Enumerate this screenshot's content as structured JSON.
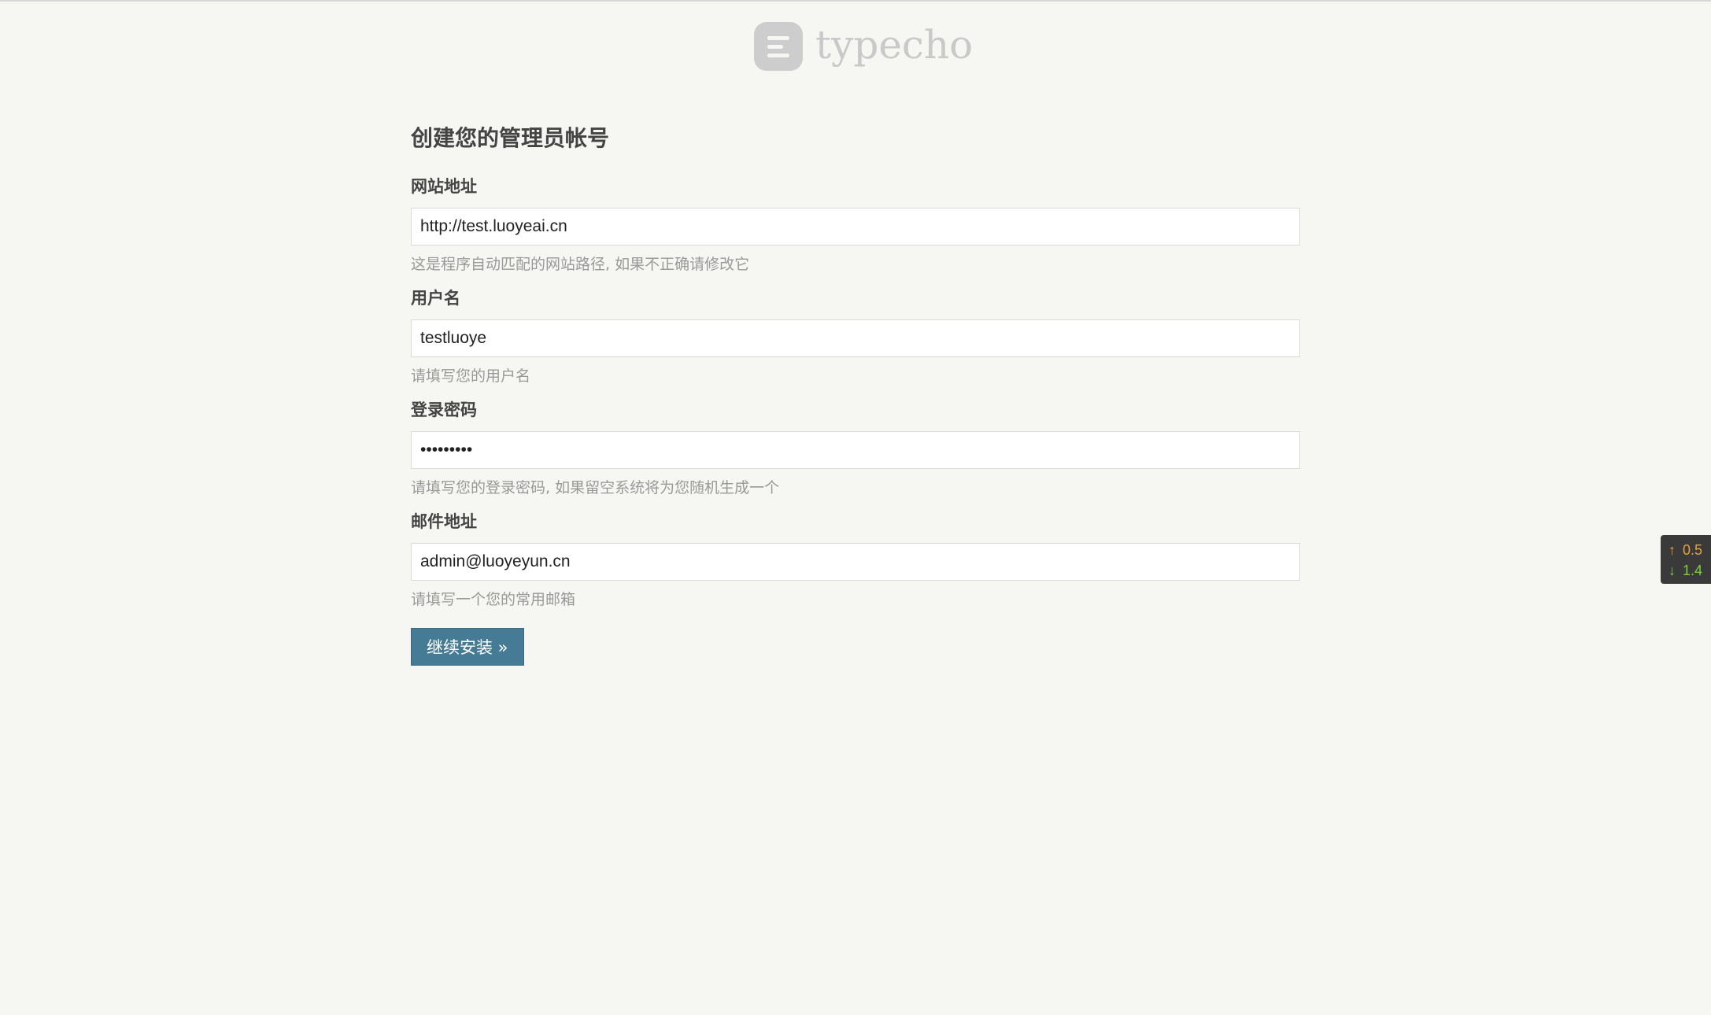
{
  "logo": {
    "text": "typecho"
  },
  "page": {
    "title": "创建您的管理员帐号"
  },
  "form": {
    "fields": [
      {
        "label": "网站地址",
        "value": "http://test.luoyeai.cn",
        "hint": "这是程序自动匹配的网站路径, 如果不正确请修改它"
      },
      {
        "label": "用户名",
        "value": "testluoye",
        "hint": "请填写您的用户名"
      },
      {
        "label": "登录密码",
        "value": "•••••••••",
        "hint": "请填写您的登录密码, 如果留空系统将为您随机生成一个"
      },
      {
        "label": "邮件地址",
        "value": "admin@luoyeyun.cn",
        "hint": "请填写一个您的常用邮箱"
      }
    ],
    "submit_label": "继续安装 »"
  },
  "net_widget": {
    "up_arrow": "↑",
    "up_value": "0.5",
    "down_arrow": "↓",
    "down_value": "1.4",
    "up_color": "#e8a23a",
    "down_color": "#7ecf3e"
  },
  "colors": {
    "background": "#f6f6f3",
    "button": "#467b96"
  }
}
